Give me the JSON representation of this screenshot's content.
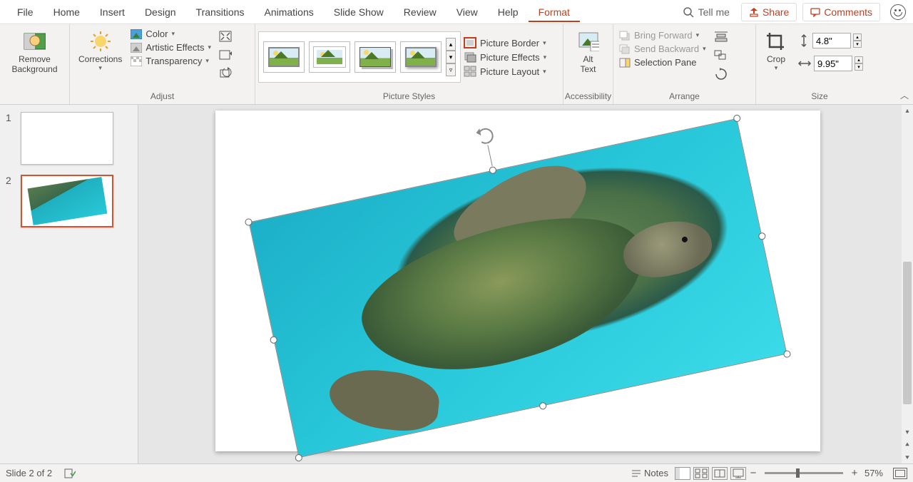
{
  "menubar": {
    "items": [
      "File",
      "Home",
      "Insert",
      "Design",
      "Transitions",
      "Animations",
      "Slide Show",
      "Review",
      "View",
      "Help",
      "Format"
    ],
    "active": "Format",
    "tellme": "Tell me",
    "share": "Share",
    "comments": "Comments"
  },
  "ribbon": {
    "remove_bg": "Remove\nBackground",
    "corrections": "Corrections",
    "color": "Color",
    "artistic": "Artistic Effects",
    "transparency": "Transparency",
    "adjust_label": "Adjust",
    "picture_styles_label": "Picture Styles",
    "picture_border": "Picture Border",
    "picture_effects": "Picture Effects",
    "picture_layout": "Picture Layout",
    "alt_text": "Alt\nText",
    "accessibility_label": "Accessibility",
    "bring_forward": "Bring Forward",
    "send_backward": "Send Backward",
    "selection_pane": "Selection Pane",
    "arrange_label": "Arrange",
    "crop": "Crop",
    "size_label": "Size",
    "height_value": "4.8\"",
    "width_value": "9.95\""
  },
  "slides": {
    "items": [
      {
        "num": "1",
        "selected": false,
        "has_image": false
      },
      {
        "num": "2",
        "selected": true,
        "has_image": true
      }
    ]
  },
  "status": {
    "slide_info": "Slide 2 of 2",
    "notes": "Notes",
    "zoom": "57%"
  }
}
